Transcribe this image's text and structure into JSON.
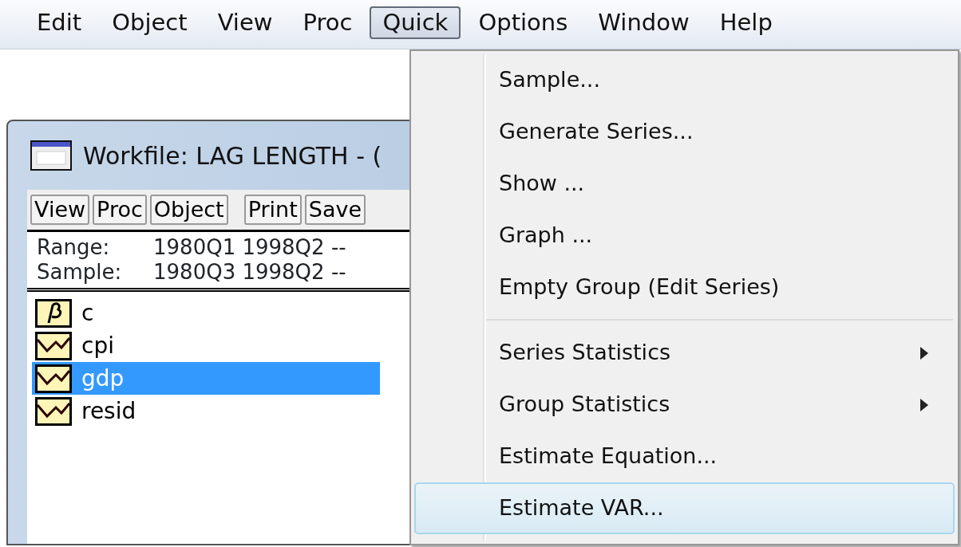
{
  "menubar": [
    {
      "label": "Edit",
      "pressed": false
    },
    {
      "label": "Object",
      "pressed": false
    },
    {
      "label": "View",
      "pressed": false
    },
    {
      "label": "Proc",
      "pressed": false
    },
    {
      "label": "Quick",
      "pressed": true
    },
    {
      "label": "Options",
      "pressed": false
    },
    {
      "label": "Window",
      "pressed": false
    },
    {
      "label": "Help",
      "pressed": false
    }
  ],
  "workfile": {
    "title": "Workfile: LAG LENGTH - (",
    "toolbar": [
      "View",
      "Proc",
      "Object",
      "Print",
      "Save"
    ],
    "info": [
      {
        "label": "Range:",
        "value": "1980Q1 1998Q2  --"
      },
      {
        "label": "Sample:",
        "value": "1980Q3 1998Q2  --"
      }
    ],
    "objects": [
      {
        "name": "c",
        "kind": "coef",
        "selected": false
      },
      {
        "name": "cpi",
        "kind": "series",
        "selected": false
      },
      {
        "name": "gdp",
        "kind": "series",
        "selected": true
      },
      {
        "name": "resid",
        "kind": "series",
        "selected": false
      }
    ]
  },
  "quick_menu": [
    {
      "label": "Sample...",
      "submenu": false,
      "highlighted": false,
      "separator_after": false
    },
    {
      "label": "Generate Series...",
      "submenu": false,
      "highlighted": false,
      "separator_after": false
    },
    {
      "label": "Show ...",
      "submenu": false,
      "highlighted": false,
      "separator_after": false
    },
    {
      "label": "Graph ...",
      "submenu": false,
      "highlighted": false,
      "separator_after": false
    },
    {
      "label": "Empty Group (Edit Series)",
      "submenu": false,
      "highlighted": false,
      "separator_after": true
    },
    {
      "label": "Series Statistics",
      "submenu": true,
      "highlighted": false,
      "separator_after": false
    },
    {
      "label": "Group Statistics",
      "submenu": true,
      "highlighted": false,
      "separator_after": false
    },
    {
      "label": "Estimate Equation...",
      "submenu": false,
      "highlighted": false,
      "separator_after": false
    },
    {
      "label": "Estimate VAR...",
      "submenu": false,
      "highlighted": true,
      "separator_after": false
    }
  ]
}
